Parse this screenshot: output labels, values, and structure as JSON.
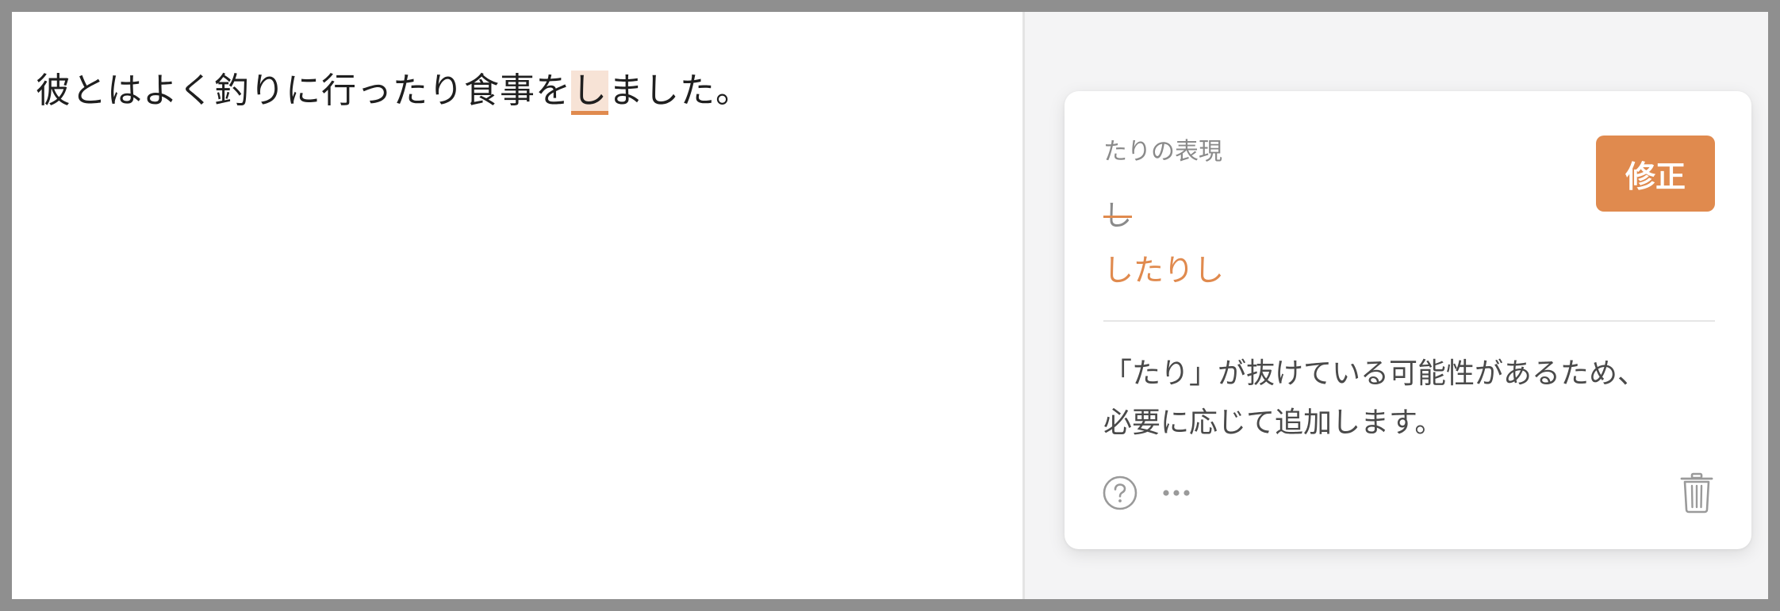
{
  "editor": {
    "text_before": "彼とはよく釣りに行ったり食事を",
    "highlighted": "し",
    "text_after": "ました。"
  },
  "suggestion": {
    "title": "たりの表現",
    "fix_button_label": "修正",
    "original": "し",
    "replacement": "したりし",
    "explanation_lines": [
      "「たり」が抜けている可能性があるため、",
      "必要に応じて追加します。"
    ]
  },
  "icons": {
    "help": "question-circle-icon",
    "more": "more-dots-icon",
    "delete": "trash-icon"
  },
  "colors": {
    "accent": "#e08a4e",
    "highlight_bg": "#f7e3d6",
    "panel_bg": "#f4f4f5",
    "muted_text": "#8a8a8a"
  }
}
